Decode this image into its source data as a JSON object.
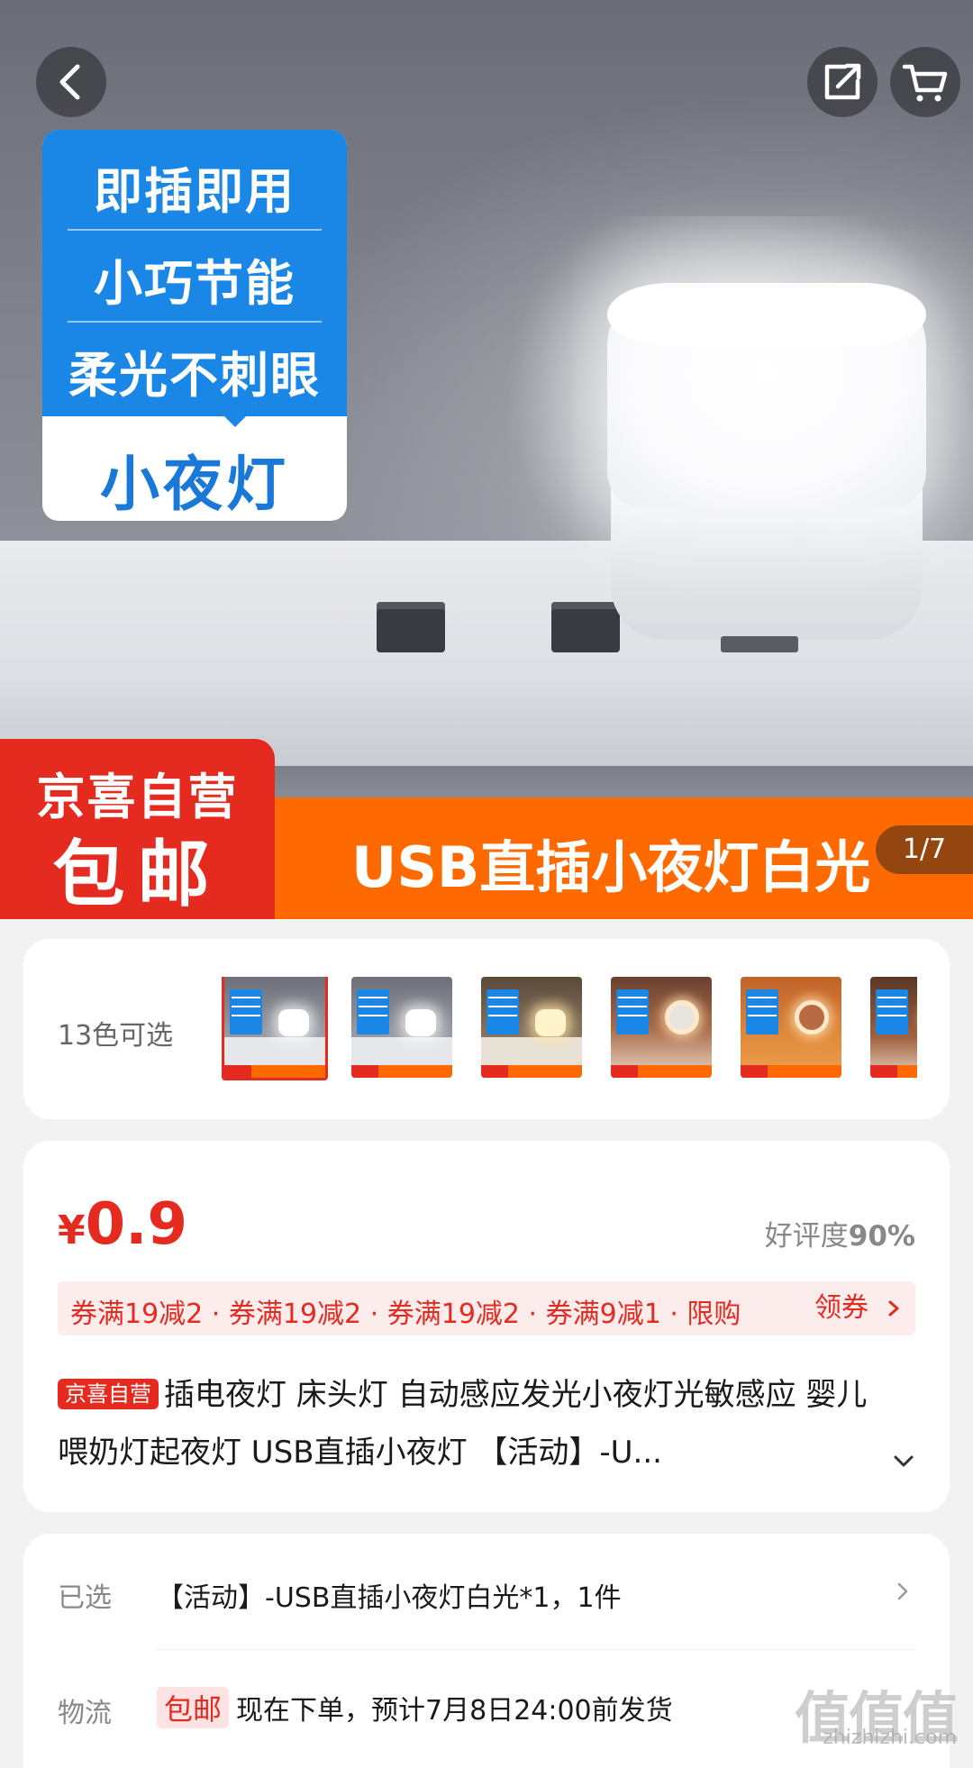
{
  "hero": {
    "callout_lines": [
      "即插即用",
      "小巧节能",
      "柔光不刺眼"
    ],
    "callout_bottom": "小夜灯",
    "banner_red_top": "京喜自营",
    "banner_red_big": "包邮",
    "banner_title": "USB直插小夜灯白光",
    "page_counter": "1/7"
  },
  "nav": {
    "back_icon": "chevron-left-icon",
    "share_icon": "share-icon",
    "cart_icon": "cart-icon"
  },
  "colors": {
    "label": "13色可选",
    "swatch_count": 6,
    "selected_index": 0
  },
  "price": {
    "symbol": "¥",
    "amount": "0.9",
    "rating_label": "好评度",
    "rating_value": "90%",
    "coupons": "券满19减2 · 券满19减2 · 券满19减2 · 券满9减1 · 限购",
    "coupon_action": "领券",
    "tag": "京喜自营",
    "title": "插电夜灯 床头灯 自动感应发光小夜灯光敏感应 婴儿喂奶灯起夜灯 USB直插小夜灯 【活动】-U..."
  },
  "selection": {
    "selected_label": "已选",
    "selected_value": "【活动】-USB直插小夜灯白光*1，1件",
    "shipping_label": "物流",
    "shipping_badge": "包邮",
    "shipping_value": "现在下单，预计7月8日24:00前发货"
  },
  "watermark": {
    "main": "值值值",
    "sub": "zhizhizhi.com"
  },
  "colors_theme": {
    "accent_red": "#e52a20",
    "accent_orange": "#ff6a00",
    "callout_blue": "#1a86e6"
  }
}
